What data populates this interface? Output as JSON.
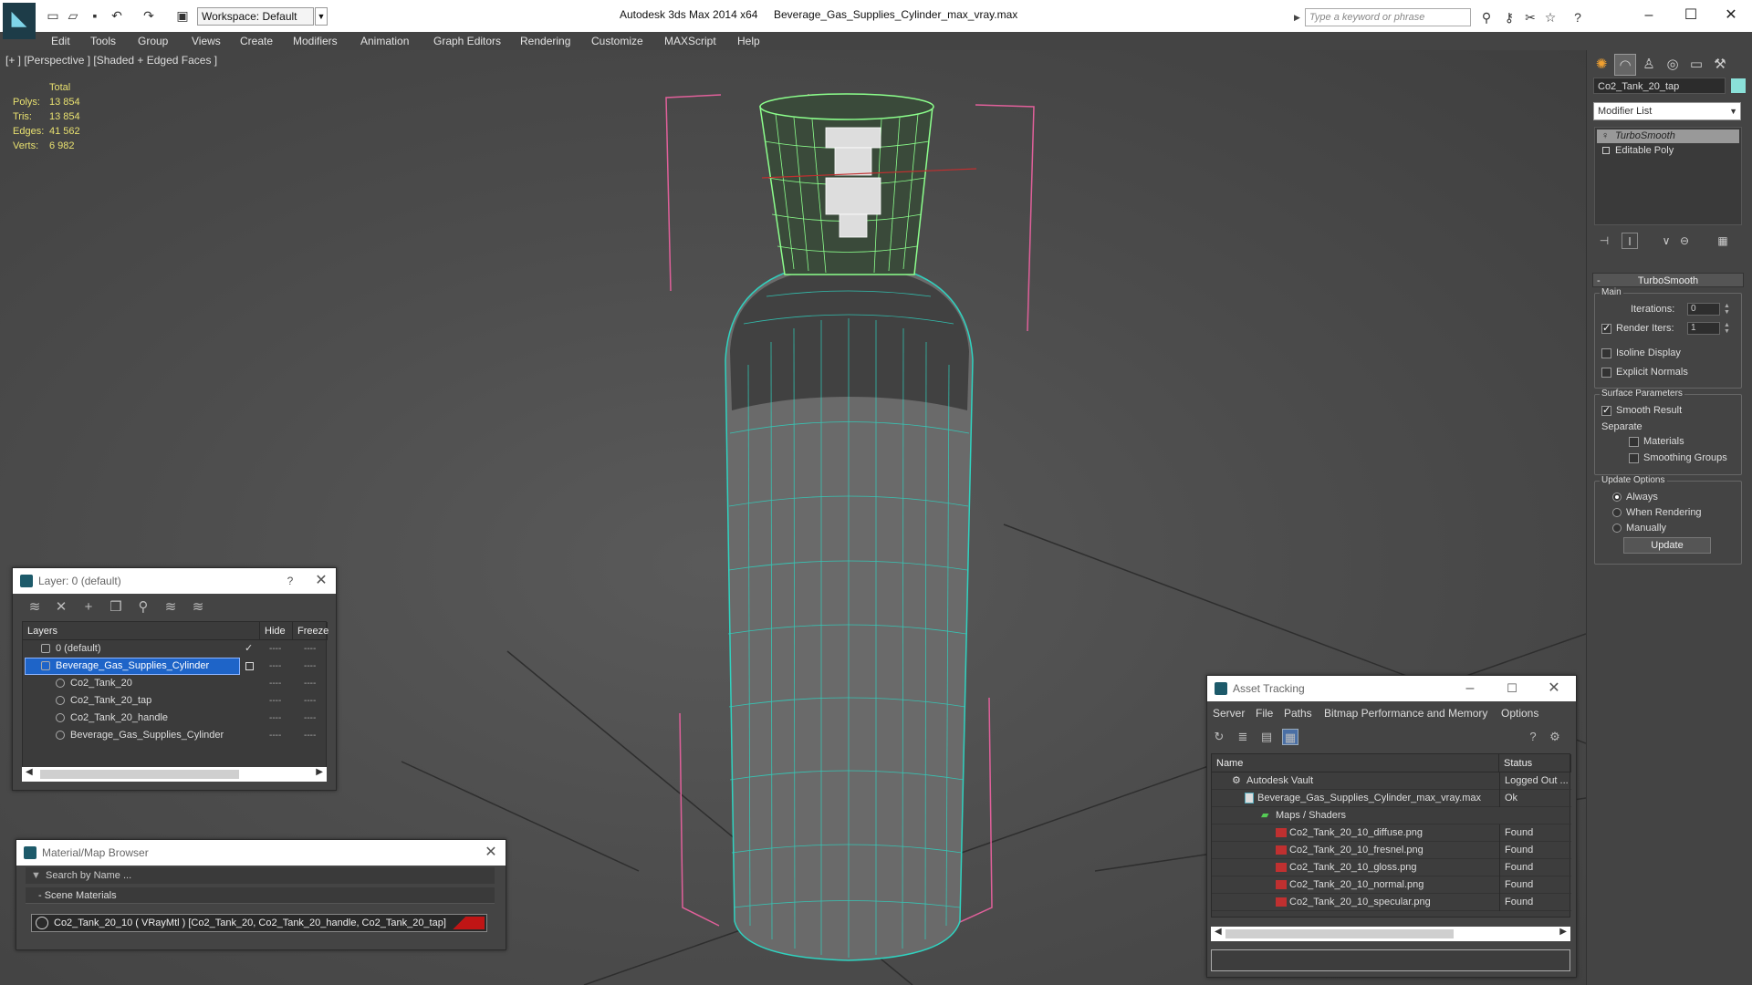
{
  "titlebar": {
    "workspace": "Workspace: Default",
    "app_title": "Autodesk 3ds Max  2014 x64",
    "file_title": "Beverage_Gas_Supplies_Cylinder_max_vray.max",
    "search_placeholder": "Type a keyword or phrase"
  },
  "menu": [
    "Edit",
    "Tools",
    "Group",
    "Views",
    "Create",
    "Modifiers",
    "Animation",
    "Graph Editors",
    "Rendering",
    "Customize",
    "MAXScript",
    "Help"
  ],
  "viewport": {
    "label": "[+ ] [Perspective ] [Shaded + Edged Faces ]",
    "stats": {
      "header": "Total",
      "rows": [
        {
          "label": "Polys:",
          "value": "13 854"
        },
        {
          "label": "Tris:",
          "value": "13 854"
        },
        {
          "label": "Edges:",
          "value": "41 562"
        },
        {
          "label": "Verts:",
          "value": "6 982"
        }
      ]
    }
  },
  "layer_panel": {
    "title": "Layer: 0 (default)",
    "help": "?",
    "columns": [
      "Layers",
      "Hide",
      "Freeze"
    ],
    "rows": [
      {
        "name": "0 (default)",
        "hide": "----",
        "freeze": "----"
      },
      {
        "name": "Beverage_Gas_Supplies_Cylinder",
        "hide": "----",
        "freeze": "----"
      },
      {
        "name": "Co2_Tank_20",
        "hide": "----",
        "freeze": "----"
      },
      {
        "name": "Co2_Tank_20_tap",
        "hide": "----",
        "freeze": "----"
      },
      {
        "name": "Co2_Tank_20_handle",
        "hide": "----",
        "freeze": "----"
      },
      {
        "name": "Beverage_Gas_Supplies_Cylinder",
        "hide": "----",
        "freeze": "----"
      }
    ]
  },
  "material_browser": {
    "title": "Material/Map Browser",
    "search": "Search by Name ...",
    "section": "- Scene Materials",
    "material": "Co2_Tank_20_10  ( VRayMtl )  [Co2_Tank_20, Co2_Tank_20_handle, Co2_Tank_20_tap]"
  },
  "asset_tracking": {
    "title": "Asset Tracking",
    "menu": [
      "Server",
      "File",
      "Paths",
      "Bitmap Performance and Memory",
      "Options"
    ],
    "columns": [
      "Name",
      "Status"
    ],
    "rows": [
      {
        "name": "Autodesk Vault",
        "status": "Logged Out ..."
      },
      {
        "name": "Beverage_Gas_Supplies_Cylinder_max_vray.max",
        "status": "Ok"
      },
      {
        "name": "Maps / Shaders",
        "status": ""
      },
      {
        "name": "Co2_Tank_20_10_diffuse.png",
        "status": "Found"
      },
      {
        "name": "Co2_Tank_20_10_fresnel.png",
        "status": "Found"
      },
      {
        "name": "Co2_Tank_20_10_gloss.png",
        "status": "Found"
      },
      {
        "name": "Co2_Tank_20_10_normal.png",
        "status": "Found"
      },
      {
        "name": "Co2_Tank_20_10_specular.png",
        "status": "Found"
      }
    ]
  },
  "command_panel": {
    "object_name": "Co2_Tank_20_tap",
    "object_color": "#8ae0d8",
    "modifier_list": "Modifier List",
    "stack": [
      "TurboSmooth",
      "Editable Poly"
    ],
    "rollout_title": "TurboSmooth",
    "main_group": "Main",
    "iterations_label": "Iterations:",
    "iterations_value": "0",
    "render_iters_label": "Render Iters:",
    "render_iters_value": "1",
    "isoline_display": "Isoline Display",
    "explicit_normals": "Explicit Normals",
    "surface_group": "Surface Parameters",
    "smooth_result": "Smooth Result",
    "separate_label": "Separate",
    "materials": "Materials",
    "smoothing_groups": "Smoothing Groups",
    "update_group": "Update Options",
    "always": "Always",
    "when_rendering": "When Rendering",
    "manually": "Manually",
    "update_button": "Update"
  },
  "colors": {
    "wire": "#2fd3c0",
    "selection_wire": "#8cff8c",
    "bbox": "#e0609a",
    "stats": "#e8e070",
    "selection": "#1e64c8"
  }
}
